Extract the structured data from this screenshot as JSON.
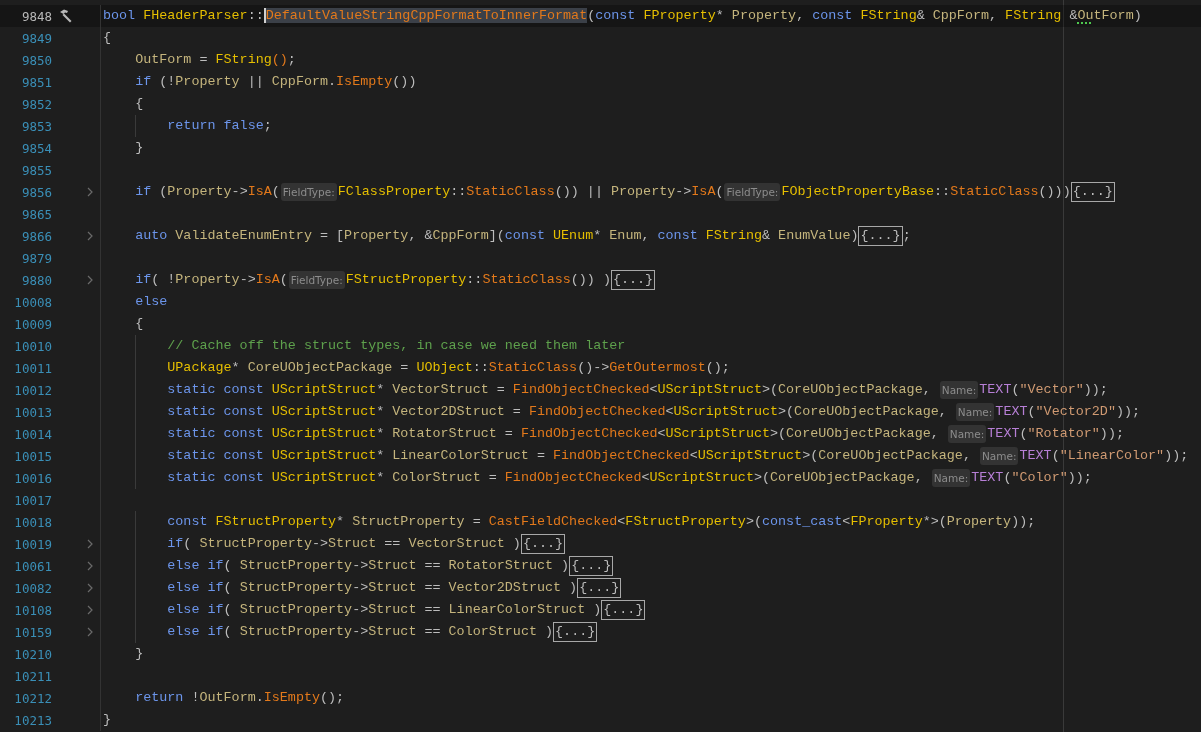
{
  "editor": {
    "lines": [
      {
        "number": "9848",
        "current": true,
        "marker": true,
        "folded": false,
        "tokens": [
          {
            "kind": "kw",
            "text": "bool "
          },
          {
            "kind": "type",
            "text": "FHeaderParser"
          },
          {
            "kind": "punct",
            "text": "::"
          },
          {
            "kind": "sel",
            "text": "DefaultValueStringCppFormatToInnerFormat"
          },
          {
            "kind": "punct",
            "text": "("
          },
          {
            "kind": "kw",
            "text": "const "
          },
          {
            "kind": "type",
            "text": "FProperty"
          },
          {
            "kind": "punct",
            "text": "* "
          },
          {
            "kind": "ident",
            "text": "Property"
          },
          {
            "kind": "punct",
            "text": ", "
          },
          {
            "kind": "kw",
            "text": "const "
          },
          {
            "kind": "type",
            "text": "FString"
          },
          {
            "kind": "punct",
            "text": "& "
          },
          {
            "kind": "ident",
            "text": "CppForm"
          },
          {
            "kind": "punct",
            "text": ", "
          },
          {
            "kind": "type",
            "text": "FString "
          },
          {
            "kind": "punct",
            "text": "&"
          },
          {
            "kind": "warn",
            "text": "Ou"
          },
          {
            "kind": "ident",
            "text": "tForm"
          },
          {
            "kind": "punct",
            "text": ")"
          }
        ]
      },
      {
        "number": "9849",
        "current": false,
        "marker": false,
        "folded": false,
        "tokens": [
          {
            "kind": "punct",
            "text": "{"
          }
        ]
      },
      {
        "number": "9850",
        "current": false,
        "marker": false,
        "folded": false,
        "tokens": [
          {
            "kind": "ident",
            "text": "    OutForm"
          },
          {
            "kind": "punct",
            "text": " = "
          },
          {
            "kind": "type",
            "text": "FString"
          },
          {
            "kind": "fn",
            "text": "()"
          },
          {
            "kind": "punct",
            "text": ";"
          }
        ]
      },
      {
        "number": "9851",
        "current": false,
        "marker": false,
        "folded": false,
        "tokens": [
          {
            "kind": "kw",
            "text": "    if "
          },
          {
            "kind": "punct",
            "text": "(!"
          },
          {
            "kind": "ident",
            "text": "Property"
          },
          {
            "kind": "punct",
            "text": " || "
          },
          {
            "kind": "ident",
            "text": "CppForm"
          },
          {
            "kind": "punct",
            "text": "."
          },
          {
            "kind": "fn",
            "text": "IsEmpty"
          },
          {
            "kind": "punct",
            "text": "())"
          }
        ]
      },
      {
        "number": "9852",
        "current": false,
        "marker": false,
        "folded": false,
        "tokens": [
          {
            "kind": "punct",
            "text": "    {"
          }
        ]
      },
      {
        "number": "9853",
        "current": false,
        "marker": false,
        "folded": false,
        "tokens": [
          {
            "kind": "kw",
            "text": "        return false"
          },
          {
            "kind": "punct",
            "text": ";"
          }
        ]
      },
      {
        "number": "9854",
        "current": false,
        "marker": false,
        "folded": false,
        "tokens": [
          {
            "kind": "punct",
            "text": "    }"
          }
        ]
      },
      {
        "number": "9855",
        "current": false,
        "marker": false,
        "folded": false
      },
      {
        "number": "9856",
        "current": false,
        "marker": false,
        "folded": true,
        "tokens": [
          {
            "kind": "kw",
            "text": "    if "
          },
          {
            "kind": "punct",
            "text": "("
          },
          {
            "kind": "ident",
            "text": "Property"
          },
          {
            "kind": "punct",
            "text": "->"
          },
          {
            "kind": "fn",
            "text": "IsA"
          },
          {
            "kind": "punct",
            "text": "("
          },
          {
            "kind": "hint",
            "text": "FieldType:"
          },
          {
            "kind": "type",
            "text": "FClassProperty"
          },
          {
            "kind": "punct",
            "text": "::"
          },
          {
            "kind": "fn",
            "text": "StaticClass"
          },
          {
            "kind": "punct",
            "text": "()) || "
          },
          {
            "kind": "ident",
            "text": "Property"
          },
          {
            "kind": "punct",
            "text": "->"
          },
          {
            "kind": "fn",
            "text": "IsA"
          },
          {
            "kind": "punct",
            "text": "("
          },
          {
            "kind": "hint",
            "text": "FieldType:"
          },
          {
            "kind": "type",
            "text": "FObjectPropertyBase"
          },
          {
            "kind": "punct",
            "text": "::"
          },
          {
            "kind": "fn",
            "text": "StaticClass"
          },
          {
            "kind": "punct",
            "text": "()))"
          },
          {
            "kind": "fold",
            "text": "{...}"
          }
        ]
      },
      {
        "number": "9865",
        "current": false,
        "marker": false,
        "folded": false
      },
      {
        "number": "9866",
        "current": false,
        "marker": false,
        "folded": true,
        "tokens": [
          {
            "kind": "kw",
            "text": "    auto "
          },
          {
            "kind": "ident",
            "text": "ValidateEnumEntry"
          },
          {
            "kind": "punct",
            "text": " = ["
          },
          {
            "kind": "ident",
            "text": "Property"
          },
          {
            "kind": "punct",
            "text": ", &"
          },
          {
            "kind": "ident",
            "text": "CppForm"
          },
          {
            "kind": "punct",
            "text": "]("
          },
          {
            "kind": "kw",
            "text": "const "
          },
          {
            "kind": "type",
            "text": "UEnum"
          },
          {
            "kind": "punct",
            "text": "* "
          },
          {
            "kind": "ident",
            "text": "Enum"
          },
          {
            "kind": "punct",
            "text": ", "
          },
          {
            "kind": "kw",
            "text": "const "
          },
          {
            "kind": "type",
            "text": "FString"
          },
          {
            "kind": "punct",
            "text": "& "
          },
          {
            "kind": "ident",
            "text": "EnumValue"
          },
          {
            "kind": "punct",
            "text": ")"
          },
          {
            "kind": "fold",
            "text": "{...}"
          },
          {
            "kind": "punct",
            "text": ";"
          }
        ]
      },
      {
        "number": "9879",
        "current": false,
        "marker": false,
        "folded": false
      },
      {
        "number": "9880",
        "current": false,
        "marker": false,
        "folded": true,
        "tokens": [
          {
            "kind": "kw",
            "text": "    if"
          },
          {
            "kind": "punct",
            "text": "( !"
          },
          {
            "kind": "ident",
            "text": "Property"
          },
          {
            "kind": "punct",
            "text": "->"
          },
          {
            "kind": "fn",
            "text": "IsA"
          },
          {
            "kind": "punct",
            "text": "("
          },
          {
            "kind": "hint",
            "text": "FieldType:"
          },
          {
            "kind": "type",
            "text": "FStructProperty"
          },
          {
            "kind": "punct",
            "text": "::"
          },
          {
            "kind": "fn",
            "text": "StaticClass"
          },
          {
            "kind": "punct",
            "text": "()) )"
          },
          {
            "kind": "fold",
            "text": "{...}"
          }
        ]
      },
      {
        "number": "10008",
        "current": false,
        "marker": false,
        "folded": false,
        "tokens": [
          {
            "kind": "kw",
            "text": "    else"
          }
        ]
      },
      {
        "number": "10009",
        "current": false,
        "marker": false,
        "folded": false,
        "tokens": [
          {
            "kind": "punct",
            "text": "    {"
          }
        ]
      },
      {
        "number": "10010",
        "current": false,
        "marker": false,
        "folded": false,
        "tokens": [
          {
            "kind": "comment",
            "text": "        // Cache off the struct types, in case we need them later"
          }
        ]
      },
      {
        "number": "10011",
        "current": false,
        "marker": false,
        "folded": false,
        "tokens": [
          {
            "kind": "type",
            "text": "        UPackage"
          },
          {
            "kind": "punct",
            "text": "* "
          },
          {
            "kind": "ident",
            "text": "CoreUObjectPackage"
          },
          {
            "kind": "punct",
            "text": " = "
          },
          {
            "kind": "type",
            "text": "UObject"
          },
          {
            "kind": "punct",
            "text": "::"
          },
          {
            "kind": "fn",
            "text": "StaticClass"
          },
          {
            "kind": "punct",
            "text": "()->"
          },
          {
            "kind": "fn",
            "text": "GetOutermost"
          },
          {
            "kind": "punct",
            "text": "();"
          }
        ]
      },
      {
        "number": "10012",
        "current": false,
        "marker": false,
        "folded": false,
        "tokens": [
          {
            "kind": "kw",
            "text": "        static const "
          },
          {
            "kind": "type",
            "text": "UScriptStruct"
          },
          {
            "kind": "punct",
            "text": "* "
          },
          {
            "kind": "ident",
            "text": "VectorStruct"
          },
          {
            "kind": "punct",
            "text": " = "
          },
          {
            "kind": "fn",
            "text": "FindObjectChecked"
          },
          {
            "kind": "punct",
            "text": "<"
          },
          {
            "kind": "type",
            "text": "UScriptStruct"
          },
          {
            "kind": "punct",
            "text": ">("
          },
          {
            "kind": "ident",
            "text": "CoreUObjectPackage"
          },
          {
            "kind": "punct",
            "text": ", "
          },
          {
            "kind": "hint",
            "text": "Name:"
          },
          {
            "kind": "macro",
            "text": "TEXT"
          },
          {
            "kind": "punct",
            "text": "("
          },
          {
            "kind": "str",
            "text": "\"Vector\""
          },
          {
            "kind": "punct",
            "text": "));"
          }
        ]
      },
      {
        "number": "10013",
        "current": false,
        "marker": false,
        "folded": false,
        "tokens": [
          {
            "kind": "kw",
            "text": "        static const "
          },
          {
            "kind": "type",
            "text": "UScriptStruct"
          },
          {
            "kind": "punct",
            "text": "* "
          },
          {
            "kind": "ident",
            "text": "Vector2DStruct"
          },
          {
            "kind": "punct",
            "text": " = "
          },
          {
            "kind": "fn",
            "text": "FindObjectChecked"
          },
          {
            "kind": "punct",
            "text": "<"
          },
          {
            "kind": "type",
            "text": "UScriptStruct"
          },
          {
            "kind": "punct",
            "text": ">("
          },
          {
            "kind": "ident",
            "text": "CoreUObjectPackage"
          },
          {
            "kind": "punct",
            "text": ", "
          },
          {
            "kind": "hint",
            "text": "Name:"
          },
          {
            "kind": "macro",
            "text": "TEXT"
          },
          {
            "kind": "punct",
            "text": "("
          },
          {
            "kind": "str",
            "text": "\"Vector2D\""
          },
          {
            "kind": "punct",
            "text": "));"
          }
        ]
      },
      {
        "number": "10014",
        "current": false,
        "marker": false,
        "folded": false,
        "tokens": [
          {
            "kind": "kw",
            "text": "        static const "
          },
          {
            "kind": "type",
            "text": "UScriptStruct"
          },
          {
            "kind": "punct",
            "text": "* "
          },
          {
            "kind": "ident",
            "text": "RotatorStruct"
          },
          {
            "kind": "punct",
            "text": " = "
          },
          {
            "kind": "fn",
            "text": "FindObjectChecked"
          },
          {
            "kind": "punct",
            "text": "<"
          },
          {
            "kind": "type",
            "text": "UScriptStruct"
          },
          {
            "kind": "punct",
            "text": ">("
          },
          {
            "kind": "ident",
            "text": "CoreUObjectPackage"
          },
          {
            "kind": "punct",
            "text": ", "
          },
          {
            "kind": "hint",
            "text": "Name:"
          },
          {
            "kind": "macro",
            "text": "TEXT"
          },
          {
            "kind": "punct",
            "text": "("
          },
          {
            "kind": "str",
            "text": "\"Rotator\""
          },
          {
            "kind": "punct",
            "text": "));"
          }
        ]
      },
      {
        "number": "10015",
        "current": false,
        "marker": false,
        "folded": false,
        "tokens": [
          {
            "kind": "kw",
            "text": "        static const "
          },
          {
            "kind": "type",
            "text": "UScriptStruct"
          },
          {
            "kind": "punct",
            "text": "* "
          },
          {
            "kind": "ident",
            "text": "LinearColorStruct"
          },
          {
            "kind": "punct",
            "text": " = "
          },
          {
            "kind": "fn",
            "text": "FindObjectChecked"
          },
          {
            "kind": "punct",
            "text": "<"
          },
          {
            "kind": "type",
            "text": "UScriptStruct"
          },
          {
            "kind": "punct",
            "text": ">("
          },
          {
            "kind": "ident",
            "text": "CoreUObjectPackage"
          },
          {
            "kind": "punct",
            "text": ", "
          },
          {
            "kind": "hint",
            "text": "Name:"
          },
          {
            "kind": "macro",
            "text": "TEXT"
          },
          {
            "kind": "punct",
            "text": "("
          },
          {
            "kind": "str",
            "text": "\"LinearColor\""
          },
          {
            "kind": "punct",
            "text": "));"
          }
        ]
      },
      {
        "number": "10016",
        "current": false,
        "marker": false,
        "folded": false,
        "tokens": [
          {
            "kind": "kw",
            "text": "        static const "
          },
          {
            "kind": "type",
            "text": "UScriptStruct"
          },
          {
            "kind": "punct",
            "text": "* "
          },
          {
            "kind": "ident",
            "text": "ColorStruct"
          },
          {
            "kind": "punct",
            "text": " = "
          },
          {
            "kind": "fn",
            "text": "FindObjectChecked"
          },
          {
            "kind": "punct",
            "text": "<"
          },
          {
            "kind": "type",
            "text": "UScriptStruct"
          },
          {
            "kind": "punct",
            "text": ">("
          },
          {
            "kind": "ident",
            "text": "CoreUObjectPackage"
          },
          {
            "kind": "punct",
            "text": ", "
          },
          {
            "kind": "hint",
            "text": "Name:"
          },
          {
            "kind": "macro",
            "text": "TEXT"
          },
          {
            "kind": "punct",
            "text": "("
          },
          {
            "kind": "str",
            "text": "\"Color\""
          },
          {
            "kind": "punct",
            "text": "));"
          }
        ]
      },
      {
        "number": "10017",
        "current": false,
        "marker": false,
        "folded": false
      },
      {
        "number": "10018",
        "current": false,
        "marker": false,
        "folded": false,
        "tokens": [
          {
            "kind": "kw",
            "text": "        const "
          },
          {
            "kind": "type",
            "text": "FStructProperty"
          },
          {
            "kind": "punct",
            "text": "* "
          },
          {
            "kind": "ident",
            "text": "StructProperty"
          },
          {
            "kind": "punct",
            "text": " = "
          },
          {
            "kind": "fn",
            "text": "CastFieldChecked"
          },
          {
            "kind": "punct",
            "text": "<"
          },
          {
            "kind": "type",
            "text": "FStructProperty"
          },
          {
            "kind": "punct",
            "text": ">("
          },
          {
            "kind": "kw",
            "text": "const_cast"
          },
          {
            "kind": "punct",
            "text": "<"
          },
          {
            "kind": "type",
            "text": "FProperty"
          },
          {
            "kind": "punct",
            "text": "*>("
          },
          {
            "kind": "ident",
            "text": "Property"
          },
          {
            "kind": "punct",
            "text": "));"
          }
        ]
      },
      {
        "number": "10019",
        "current": false,
        "marker": false,
        "folded": true,
        "tokens": [
          {
            "kind": "kw",
            "text": "        if"
          },
          {
            "kind": "punct",
            "text": "( "
          },
          {
            "kind": "ident",
            "text": "StructProperty"
          },
          {
            "kind": "punct",
            "text": "->"
          },
          {
            "kind": "ident",
            "text": "Struct"
          },
          {
            "kind": "punct",
            "text": " == "
          },
          {
            "kind": "ident",
            "text": "VectorStruct"
          },
          {
            "kind": "punct",
            "text": " )"
          },
          {
            "kind": "fold",
            "text": "{...}"
          }
        ]
      },
      {
        "number": "10061",
        "current": false,
        "marker": false,
        "folded": true,
        "tokens": [
          {
            "kind": "kw",
            "text": "        else if"
          },
          {
            "kind": "punct",
            "text": "( "
          },
          {
            "kind": "ident",
            "text": "StructProperty"
          },
          {
            "kind": "punct",
            "text": "->"
          },
          {
            "kind": "ident",
            "text": "Struct"
          },
          {
            "kind": "punct",
            "text": " == "
          },
          {
            "kind": "ident",
            "text": "RotatorStruct"
          },
          {
            "kind": "punct",
            "text": " )"
          },
          {
            "kind": "fold",
            "text": "{...}"
          }
        ]
      },
      {
        "number": "10082",
        "current": false,
        "marker": false,
        "folded": true,
        "tokens": [
          {
            "kind": "kw",
            "text": "        else if"
          },
          {
            "kind": "punct",
            "text": "( "
          },
          {
            "kind": "ident",
            "text": "StructProperty"
          },
          {
            "kind": "punct",
            "text": "->"
          },
          {
            "kind": "ident",
            "text": "Struct"
          },
          {
            "kind": "punct",
            "text": " == "
          },
          {
            "kind": "ident",
            "text": "Vector2DStruct"
          },
          {
            "kind": "punct",
            "text": " )"
          },
          {
            "kind": "fold",
            "text": "{...}"
          }
        ]
      },
      {
        "number": "10108",
        "current": false,
        "marker": false,
        "folded": true,
        "tokens": [
          {
            "kind": "kw",
            "text": "        else if"
          },
          {
            "kind": "punct",
            "text": "( "
          },
          {
            "kind": "ident",
            "text": "StructProperty"
          },
          {
            "kind": "punct",
            "text": "->"
          },
          {
            "kind": "ident",
            "text": "Struct"
          },
          {
            "kind": "punct",
            "text": " == "
          },
          {
            "kind": "ident",
            "text": "LinearColorStruct"
          },
          {
            "kind": "punct",
            "text": " )"
          },
          {
            "kind": "fold",
            "text": "{...}"
          }
        ]
      },
      {
        "number": "10159",
        "current": false,
        "marker": false,
        "folded": true,
        "tokens": [
          {
            "kind": "kw",
            "text": "        else if"
          },
          {
            "kind": "punct",
            "text": "( "
          },
          {
            "kind": "ident",
            "text": "StructProperty"
          },
          {
            "kind": "punct",
            "text": "->"
          },
          {
            "kind": "ident",
            "text": "Struct"
          },
          {
            "kind": "punct",
            "text": " == "
          },
          {
            "kind": "ident",
            "text": "ColorStruct"
          },
          {
            "kind": "punct",
            "text": " )"
          },
          {
            "kind": "fold",
            "text": "{...}"
          }
        ]
      },
      {
        "number": "10210",
        "current": false,
        "marker": false,
        "folded": false,
        "tokens": [
          {
            "kind": "punct",
            "text": "    }"
          }
        ]
      },
      {
        "number": "10211",
        "current": false,
        "marker": false,
        "folded": false
      },
      {
        "number": "10212",
        "current": false,
        "marker": false,
        "folded": false,
        "tokens": [
          {
            "kind": "kw",
            "text": "    return "
          },
          {
            "kind": "punct",
            "text": "!"
          },
          {
            "kind": "ident",
            "text": "OutForm"
          },
          {
            "kind": "punct",
            "text": "."
          },
          {
            "kind": "fn",
            "text": "IsEmpty"
          },
          {
            "kind": "punct",
            "text": "();"
          }
        ]
      },
      {
        "number": "10213",
        "current": false,
        "marker": false,
        "folded": false,
        "tokens": [
          {
            "kind": "punct",
            "text": "}"
          }
        ]
      }
    ]
  }
}
